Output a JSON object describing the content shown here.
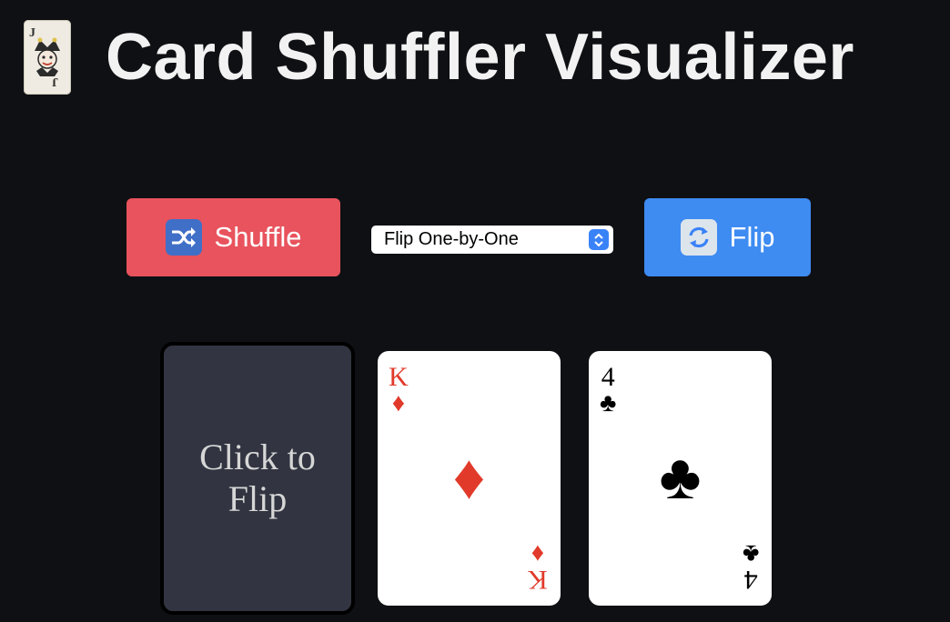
{
  "header": {
    "title": "Card Shuffler Visualizer",
    "icon": "joker-card-icon"
  },
  "controls": {
    "shuffle_label": "Shuffle",
    "shuffle_icon": "shuffle-icon",
    "flip_label": "Flip",
    "flip_icon": "refresh-icon",
    "mode_select": {
      "selected": "Flip One-by-One"
    }
  },
  "colors": {
    "background": "#0f1014",
    "shuffle_button": "#e8535d",
    "flip_button": "#3e8bf2",
    "card_back": "#323541",
    "red_suit": "#e13a2a"
  },
  "cards": [
    {
      "face": "back",
      "text": "Click to Flip"
    },
    {
      "face": "up",
      "rank": "K",
      "suit": "♦",
      "suit_name": "diamonds",
      "color": "red"
    },
    {
      "face": "up",
      "rank": "4",
      "suit": "♣",
      "suit_name": "clubs",
      "color": "black"
    }
  ]
}
